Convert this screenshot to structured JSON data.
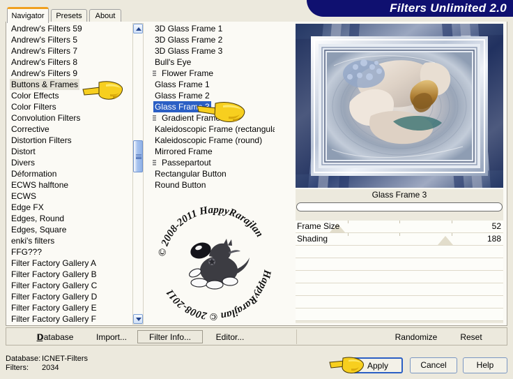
{
  "window": {
    "title": "Filters Unlimited 2.0"
  },
  "tabs": [
    {
      "label": "Navigator",
      "active": true
    },
    {
      "label": "Presets",
      "active": false
    },
    {
      "label": "About",
      "active": false
    }
  ],
  "categories": {
    "name": "filter-category-list",
    "selected": "Buttons & Frames",
    "items": [
      "Andrew's Filters 59",
      "Andrew's Filters 5",
      "Andrew's Filters 7",
      "Andrew's Filters 8",
      "Andrew's Filters 9",
      "Buttons & Frames",
      "Color Effects",
      "Color Filters",
      "Convolution Filters",
      "Corrective",
      "Distortion Filters",
      "Distort",
      "Divers",
      "Déformation",
      "ECWS halftone",
      "ECWS",
      "Edge FX",
      "Edges, Round",
      "Edges, Square",
      "enki's filters",
      "FFG???",
      "Filter Factory Gallery A",
      "Filter Factory Gallery B",
      "Filter Factory Gallery C",
      "Filter Factory Gallery D",
      "Filter Factory Gallery E",
      "Filter Factory Gallery F"
    ]
  },
  "filters": {
    "name": "filter-effect-list",
    "selected": "Glass Frame 3",
    "items": [
      {
        "label": "3D Glass Frame 1",
        "marked": false
      },
      {
        "label": "3D Glass Frame 2",
        "marked": false
      },
      {
        "label": "3D Glass Frame 3",
        "marked": false
      },
      {
        "label": "Bull's Eye",
        "marked": false
      },
      {
        "label": "Flower Frame",
        "marked": true
      },
      {
        "label": "Glass Frame 1",
        "marked": false
      },
      {
        "label": "Glass Frame 2",
        "marked": false
      },
      {
        "label": "Glass Frame 3",
        "marked": false
      },
      {
        "label": "Gradient Frame",
        "marked": true
      },
      {
        "label": "Kaleidoscopic Frame (rectangular)",
        "marked": false
      },
      {
        "label": "Kaleidoscopic Frame (round)",
        "marked": false
      },
      {
        "label": "Mirrored Frame",
        "marked": false
      },
      {
        "label": "Passepartout",
        "marked": true
      },
      {
        "label": "Rectangular Button",
        "marked": false
      },
      {
        "label": "Round Button",
        "marked": false
      }
    ]
  },
  "watermark": {
    "arc_text_top": "© 2008-2011  HappyRarajlan",
    "arc_text_bottom": "HappyRarajlan © 2008-2011"
  },
  "params": {
    "title": "Glass Frame 3",
    "progress_value": "",
    "sliders": [
      {
        "name": "Frame Size",
        "value": "52",
        "percent": 20
      },
      {
        "name": "Shading",
        "value": "188",
        "percent": 72
      }
    ],
    "empty_rows": 6
  },
  "toolbar": {
    "database": "Database",
    "import": "Import...",
    "filter_info": "Filter Info...",
    "editor": "Editor...",
    "randomize": "Randomize",
    "reset": "Reset"
  },
  "status": {
    "database_label": "Database:",
    "database_value": "ICNET-Filters",
    "filters_label": "Filters:",
    "filters_value": "2034"
  },
  "dialog_buttons": {
    "apply": "Apply",
    "cancel": "Cancel",
    "help": "Help"
  },
  "colors": {
    "banner": "#0f1070",
    "accent_tab": "#f0a020",
    "selection_active": "#2b5fc4",
    "selection_inactive": "#e4e1d6",
    "window_bg": "#ece9dd",
    "list_bg": "#fbfaf5"
  }
}
